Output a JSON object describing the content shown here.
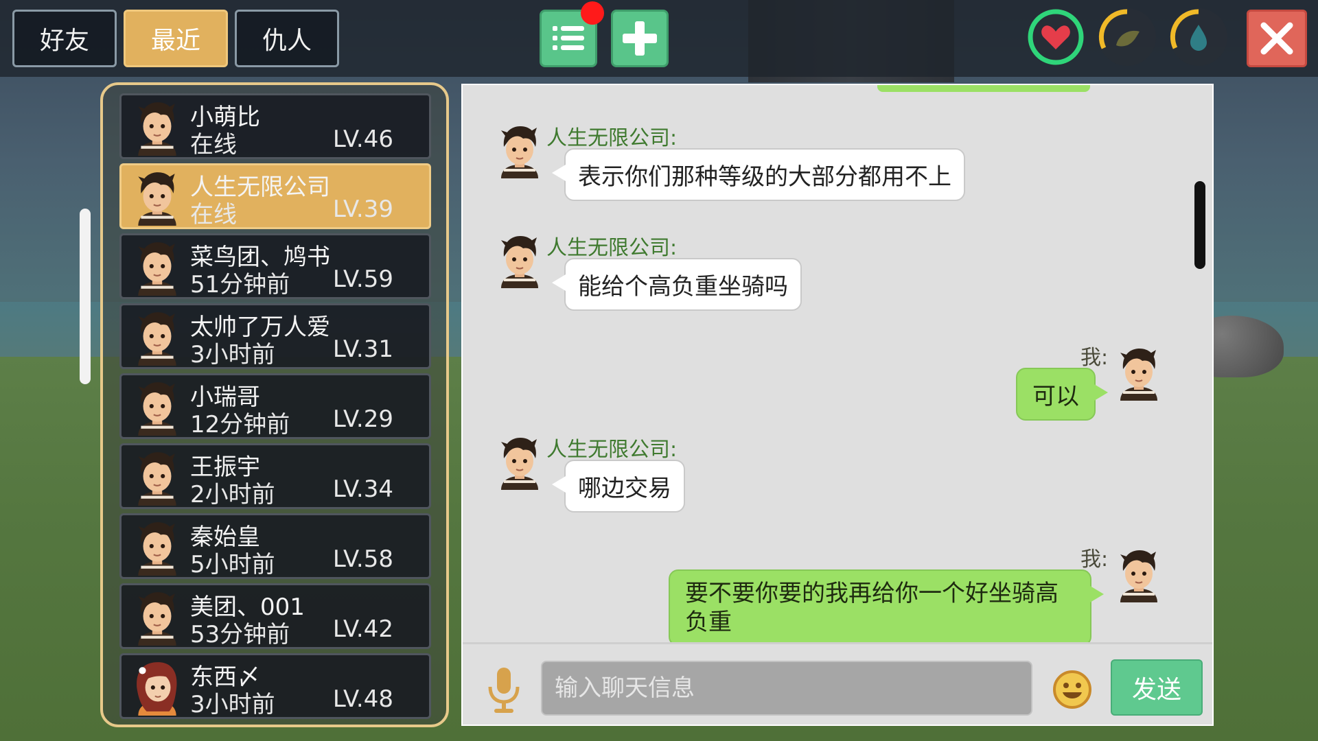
{
  "top_tabs": {
    "friends": "好友",
    "recent": "最近",
    "enemies": "仇人"
  },
  "top_icons": {
    "list": "list-icon",
    "add": "plus-icon",
    "notification_color": "#ff1a1a",
    "health": "heart-icon",
    "hunger": "food-icon",
    "thirst": "water-drop-icon",
    "close": "close-icon"
  },
  "friends": [
    {
      "name": "小萌比",
      "status": "在线",
      "level": "LV.46"
    },
    {
      "name": "人生无限公司",
      "status": "在线",
      "level": "LV.39",
      "selected": true
    },
    {
      "name": "菜鸟团、鸠书",
      "status": "51分钟前",
      "level": "LV.59"
    },
    {
      "name": "太帅了万人爱",
      "status": "3小时前",
      "level": "LV.31"
    },
    {
      "name": "小瑞哥",
      "status": "12分钟前",
      "level": "LV.29"
    },
    {
      "name": "王振宇",
      "status": "2小时前",
      "level": "LV.34"
    },
    {
      "name": "秦始皇",
      "status": "5小时前",
      "level": "LV.58"
    },
    {
      "name": "美团、001",
      "status": "53分钟前",
      "level": "LV.42"
    },
    {
      "name": "东西〆",
      "status": "3小时前",
      "level": "LV.48"
    }
  ],
  "chat": {
    "messages": [
      {
        "sender": "人生无限公司:",
        "text": "表示你们那种等级的大部分都用不上",
        "mine": false
      },
      {
        "sender": "人生无限公司:",
        "text": "能给个高负重坐骑吗",
        "mine": false
      },
      {
        "sender": "我:",
        "text": "可以",
        "mine": true
      },
      {
        "sender": "人生无限公司:",
        "text": "哪边交易",
        "mine": false
      },
      {
        "sender": "我:",
        "text": "要不要你要的我再给你一个好坐骑高负重",
        "mine": true
      }
    ],
    "input_placeholder": "输入聊天信息",
    "send_label": "发送",
    "mic_icon": "microphone-icon",
    "emoji_icon": "smiley-icon"
  },
  "colors": {
    "accent_tab": "#e1b15e",
    "button_green": "#59c58a",
    "my_bubble": "#9be065",
    "sender_green": "#3f7a2f",
    "close_red": "#e0665a"
  }
}
